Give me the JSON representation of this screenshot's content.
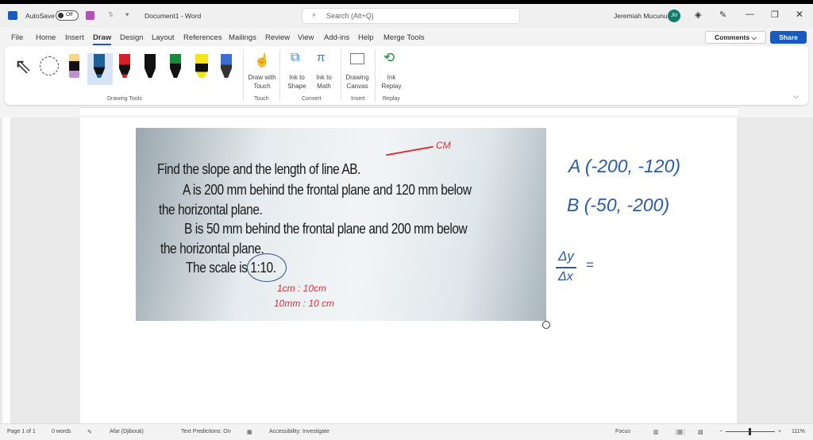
{
  "titlebar": {
    "autosave": "AutoSave",
    "toggle": "Off",
    "doc_title": "Document1 - Word",
    "search_placeholder": "Search (Alt+Q)",
    "user": "Jeremiah Mucunu",
    "initials": "JM"
  },
  "tabs": [
    "File",
    "Home",
    "Insert",
    "Draw",
    "Design",
    "Layout",
    "References",
    "Mailings",
    "Review",
    "View",
    "Add-ins",
    "Help",
    "Merge Tools"
  ],
  "active_tab": "Draw",
  "actions": {
    "comments": "Comments",
    "share": "Share"
  },
  "ribbon": {
    "groups": [
      "Drawing Tools",
      "Touch",
      "Convert",
      "Insert",
      "Replay"
    ],
    "buttons": [
      {
        "l1": "Draw with",
        "l2": "Touch"
      },
      {
        "l1": "Ink to",
        "l2": "Shape"
      },
      {
        "l1": "Ink to",
        "l2": "Math"
      },
      {
        "l1": "Drawing",
        "l2": "Canvas"
      },
      {
        "l1": "Ink",
        "l2": "Replay"
      }
    ],
    "pen_colors": [
      "#000000",
      "#1f5f99",
      "#d42027",
      "#111111",
      "#1a8a3a",
      "#f5e61a",
      "#3a6fd1"
    ]
  },
  "photo": {
    "lines": [
      "Find the slope and the length of line AB.",
      "A is 200 mm behind the frontal plane and 120 mm below",
      "the horizontal plane.",
      "B is 50 mm behind the frontal plane and 200 mm below",
      "the horizontal plane.",
      "The scale is 1:10."
    ],
    "annotations": [
      "CM",
      "1cm : 10cm",
      "10mm : 10 cm"
    ]
  },
  "ink": {
    "a": "A (-200, -120)",
    "b": "B (-50, -200)",
    "slope_num": "Δy",
    "slope_den": "Δx",
    "eq": "="
  },
  "status": {
    "page": "Page 1 of 1",
    "words": "0 words",
    "language": "Afar (Djibouti)",
    "predictions": "Text Predictions: On",
    "accessibility": "Accessibility: Investigate",
    "focus": "Focus",
    "zoom": "111%"
  }
}
